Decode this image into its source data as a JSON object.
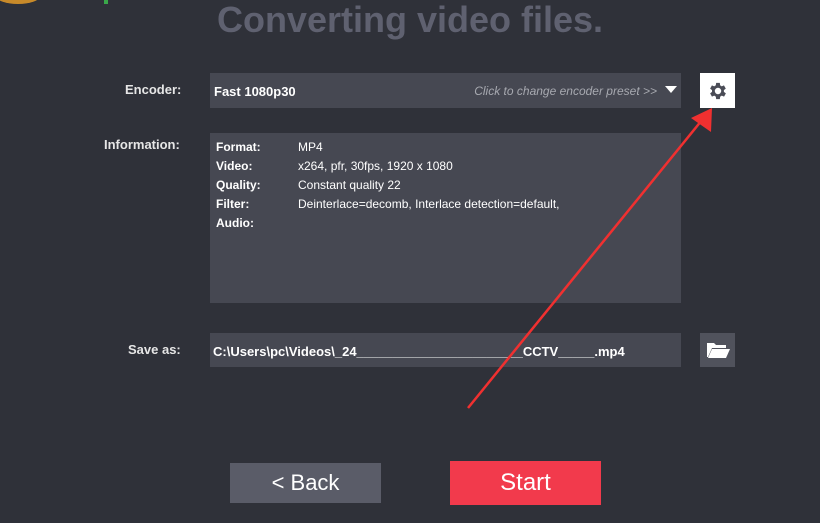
{
  "header": {
    "title": "Converting video files."
  },
  "encoder": {
    "label": "Encoder:",
    "value": "Fast 1080p30",
    "hint": "Click to change encoder preset >>",
    "settings_icon": "gear-icon"
  },
  "information": {
    "label": "Information:",
    "rows": [
      {
        "key": "Format:",
        "value": "MP4"
      },
      {
        "key": "Video:",
        "value": "x264, pfr, 30fps, 1920 x 1080"
      },
      {
        "key": "Quality:",
        "value": "Constant quality 22"
      },
      {
        "key": "Filter:",
        "value": "Deinterlace=decomb, Interlace detection=default,"
      },
      {
        "key": "Audio:",
        "value": ""
      }
    ]
  },
  "save_as": {
    "label": "Save as:",
    "path": "C:\\Users\\pc\\Videos\\_24_______________________CCTV_____.mp4",
    "browse_icon": "folder-open-icon"
  },
  "buttons": {
    "back": "<  Back",
    "start": "Start"
  },
  "colors": {
    "background": "#2f3139",
    "field": "#464852",
    "start": "#f23a4c",
    "back": "#5a5c68",
    "annotation_arrow": "#f03030"
  }
}
